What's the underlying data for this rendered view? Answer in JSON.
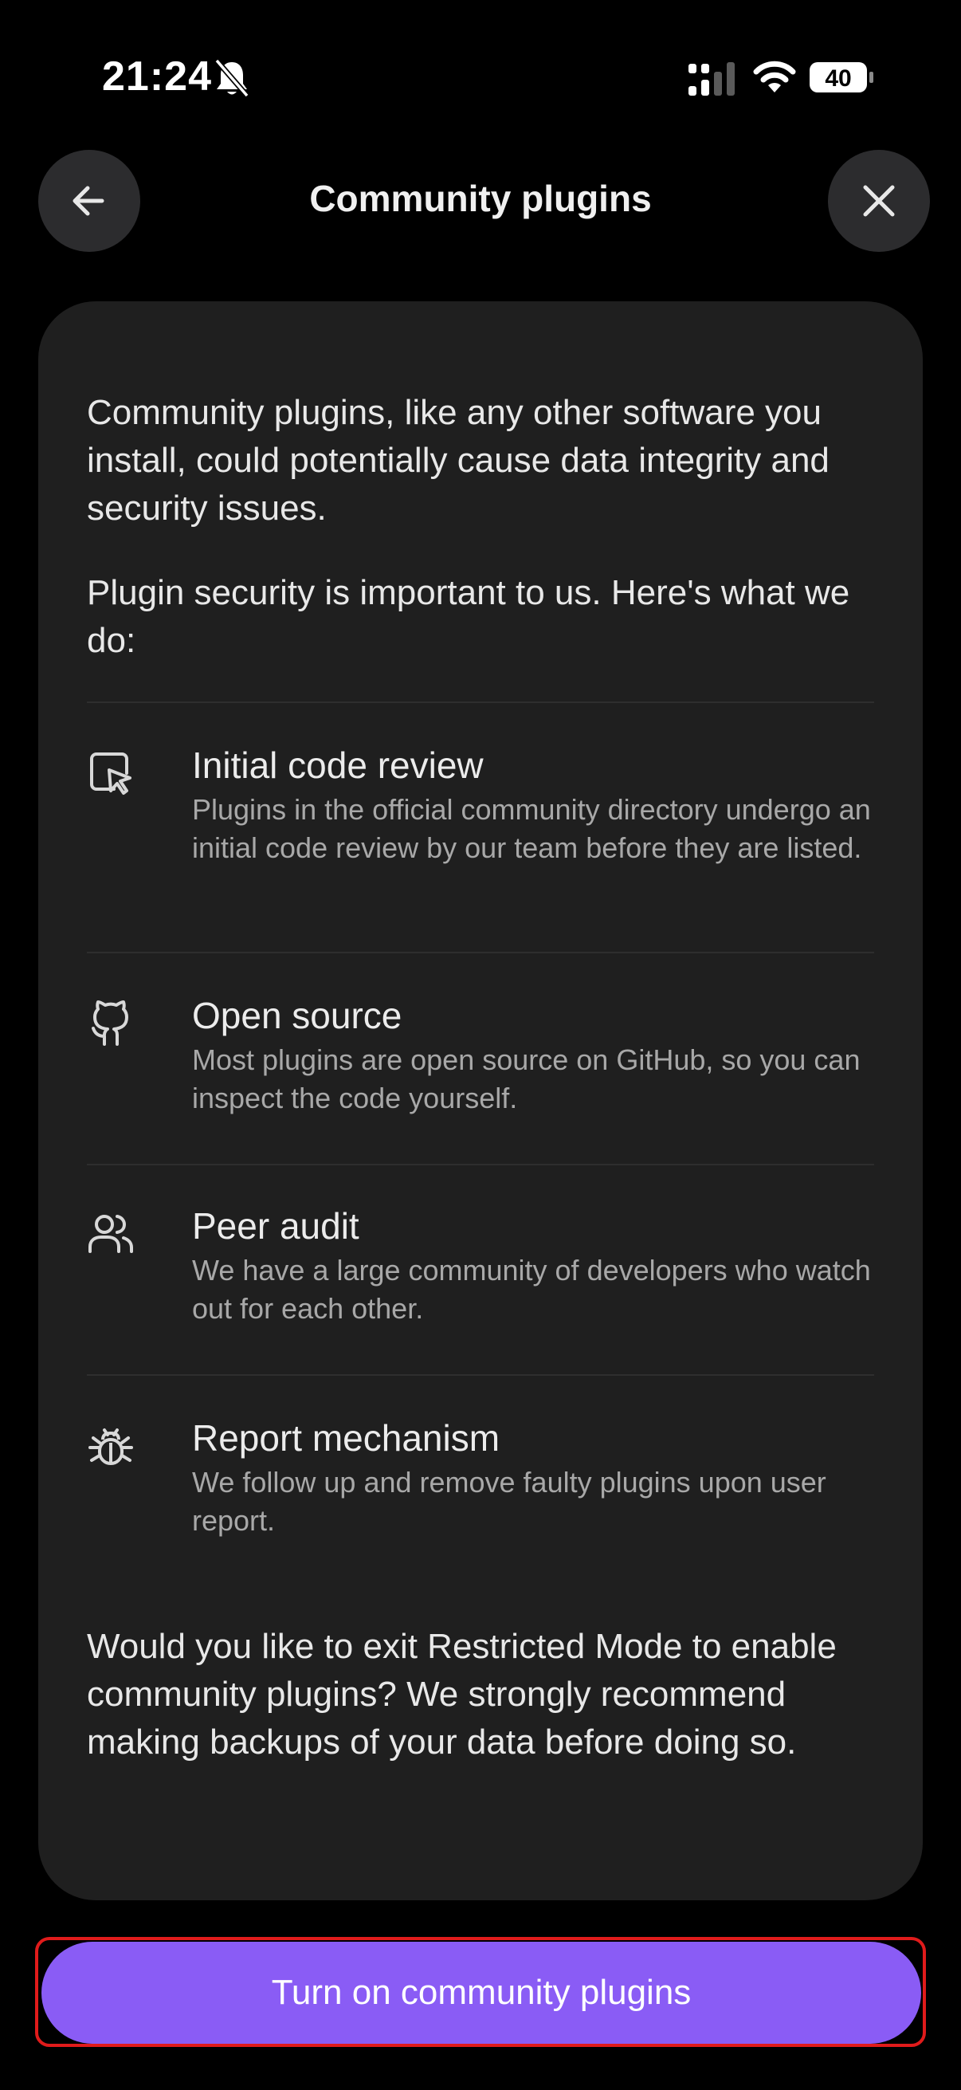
{
  "status_bar": {
    "time": "21:24",
    "battery": "40",
    "icons": [
      "bell-slash-icon",
      "cellular-signal-icon",
      "wifi-icon",
      "battery-icon"
    ]
  },
  "header": {
    "title": "Community plugins",
    "back_icon": "arrow-left-icon",
    "close_icon": "close-icon"
  },
  "card": {
    "intro_1": "Community plugins, like any other software you install, could potentially cause data integrity and security issues.",
    "intro_2": "Plugin security is important to us. Here's what we do:",
    "features": [
      {
        "icon": "pointer-box-icon",
        "title": "Initial code review",
        "description": "Plugins in the official community directory undergo an initial code review by our team before they are listed."
      },
      {
        "icon": "github-icon",
        "title": "Open source",
        "description": "Most plugins are open source on GitHub, so you can inspect the code yourself."
      },
      {
        "icon": "users-icon",
        "title": "Peer audit",
        "description": "We have a large community of developers who watch out for each other."
      },
      {
        "icon": "bug-icon",
        "title": "Report mechanism",
        "description": "We follow up and remove faulty plugins upon user report."
      }
    ],
    "outro": "Would you like to exit Restricted Mode to enable community plugins? We strongly recommend making backups of your data before doing so."
  },
  "actions": {
    "primary_label": "Turn on community plugins"
  },
  "colors": {
    "accent": "#8a5cf5",
    "highlight": "#e01b1b",
    "card_bg": "#1f1f1f",
    "background": "#000000"
  }
}
